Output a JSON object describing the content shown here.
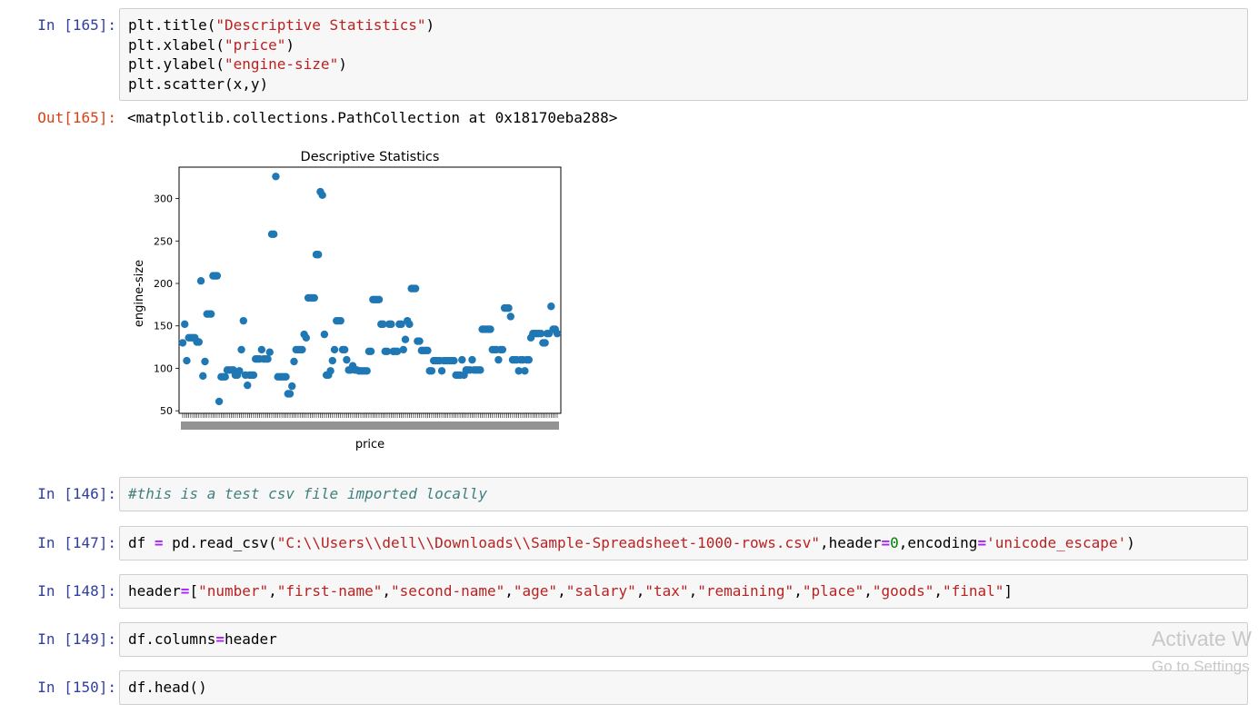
{
  "cells": {
    "c165": {
      "in_prompt": "In [165]:",
      "out_prompt": "Out[165]:",
      "lines": {
        "l1a": "plt.title(",
        "l1b": "\"Descriptive Statistics\"",
        "l1c": ")",
        "l2a": "plt.xlabel(",
        "l2b": "\"price\"",
        "l2c": ")",
        "l3a": "plt.ylabel(",
        "l3b": "\"engine-size\"",
        "l3c": ")",
        "l4": "plt.scatter(x,y)"
      },
      "output": "<matplotlib.collections.PathCollection at 0x18170eba288>"
    },
    "c146": {
      "in_prompt": "In [146]:",
      "comment": "#this is a test csv file imported locally"
    },
    "c147": {
      "in_prompt": "In [147]:",
      "a": "df ",
      "eq": "=",
      "b": " pd.read_csv(",
      "path": "\"C:\\\\Users\\\\dell\\\\Downloads\\\\Sample-Spreadsheet-1000-rows.csv\"",
      "c": ",header",
      "eq2": "=",
      "zero": "0",
      "d": ",encoding",
      "eq3": "=",
      "enc": "'unicode_escape'",
      "e": ")"
    },
    "c148": {
      "in_prompt": "In [148]:",
      "a": "header",
      "eq": "=",
      "open": "[",
      "items": [
        "\"number\"",
        "\"first-name\"",
        "\"second-name\"",
        "\"age\"",
        "\"salary\"",
        "\"tax\"",
        "\"remaining\"",
        "\"place\"",
        "\"goods\"",
        "\"final\""
      ],
      "close": "]"
    },
    "c149": {
      "in_prompt": "In [149]:",
      "a": "df.columns",
      "eq": "=",
      "b": "header"
    },
    "c150": {
      "in_prompt": "In [150]:",
      "a": "df.head()"
    }
  },
  "watermark": {
    "title": "Activate W",
    "subtitle": "Go to Settings"
  },
  "colors": {
    "in_prompt": "#303f9f",
    "out_prompt": "#d84315",
    "string": "#ba2121",
    "operator": "#aa22ff",
    "number": "#008000",
    "comment": "#408080",
    "marker": "#1f77b4",
    "cell_bg": "#f7f7f7",
    "cell_border": "#cfcfcf"
  },
  "chart_data": {
    "type": "scatter",
    "title": "Descriptive Statistics",
    "xlabel": "price",
    "ylabel": "engine-size",
    "ylim": [
      47,
      337
    ],
    "yticks": [
      50,
      100,
      150,
      200,
      250,
      300
    ],
    "ytick_labels": [
      "50",
      "100",
      "150",
      "200",
      "250",
      "300"
    ],
    "x_tick_count": 186,
    "grid": false,
    "legend": "none",
    "color": "#1f77b4",
    "y": [
      130,
      152,
      109,
      136,
      136,
      136,
      136,
      131,
      131,
      203,
      91,
      108,
      164,
      164,
      164,
      209,
      209,
      209,
      61,
      90,
      90,
      90,
      98,
      98,
      98,
      98,
      92,
      92,
      97,
      122,
      156,
      92,
      80,
      92,
      92,
      92,
      111,
      111,
      111,
      122,
      111,
      111,
      111,
      119,
      258,
      258,
      326,
      90,
      90,
      90,
      90,
      90,
      70,
      70,
      79,
      108,
      122,
      122,
      122,
      122,
      140,
      136,
      183,
      183,
      183,
      183,
      234,
      234,
      308,
      304,
      140,
      92,
      92,
      97,
      109,
      122,
      156,
      156,
      156,
      122,
      122,
      110,
      98,
      98,
      103,
      98,
      98,
      97,
      97,
      97,
      97,
      97,
      120,
      120,
      181,
      181,
      181,
      181,
      152,
      152,
      120,
      120,
      152,
      152,
      120,
      120,
      120,
      152,
      152,
      122,
      134,
      156,
      152,
      194,
      194,
      194,
      132,
      132,
      121,
      121,
      121,
      121,
      97,
      97,
      109,
      109,
      109,
      109,
      97,
      109,
      109,
      109,
      109,
      109,
      109,
      92,
      92,
      92,
      110,
      92,
      98,
      98,
      98,
      110,
      98,
      98,
      98,
      98,
      146,
      146,
      146,
      146,
      146,
      122,
      122,
      122,
      110,
      122,
      122,
      171,
      171,
      171,
      161,
      110,
      110,
      110,
      97,
      110,
      110,
      97,
      110,
      110,
      136,
      141,
      141,
      141,
      141,
      141,
      130,
      130,
      141,
      141,
      173,
      146,
      146,
      141
    ]
  }
}
